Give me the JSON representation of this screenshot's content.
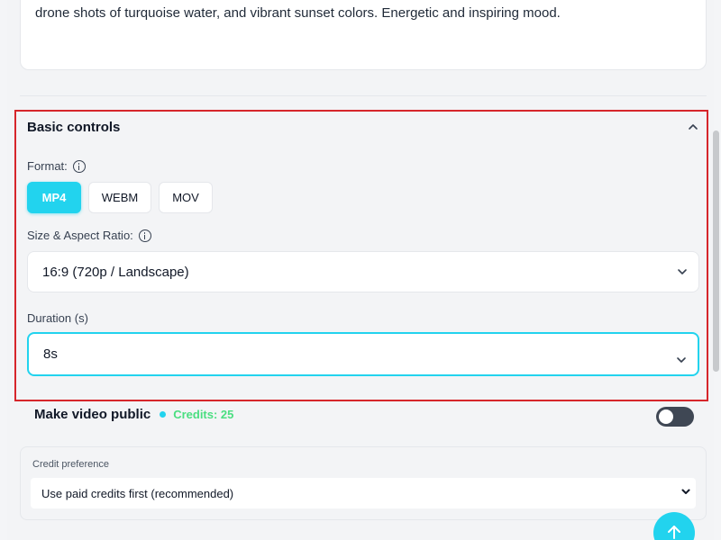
{
  "prompt": {
    "text": "drone shots of turquoise water, and vibrant sunset colors. Energetic and inspiring mood."
  },
  "basic_controls": {
    "title": "Basic controls",
    "format": {
      "label": "Format:",
      "options": [
        "MP4",
        "WEBM",
        "MOV"
      ],
      "selected": "MP4"
    },
    "size": {
      "label": "Size & Aspect Ratio:",
      "value": "16:9 (720p / Landscape)"
    },
    "duration": {
      "label": "Duration (s)",
      "value": "8s"
    }
  },
  "public": {
    "label": "Make video public",
    "credits": "Credits: 25",
    "toggle_on": false
  },
  "credit_preference": {
    "label": "Credit preference",
    "value": "Use paid credits first (recommended)"
  },
  "colors": {
    "accent": "#22d3ee",
    "credits": "#4ade80",
    "highlight_border": "#d6262b"
  },
  "icons": {
    "collapse": "chevron-up-icon",
    "info": "info-icon",
    "dropdown": "chevron-down-icon",
    "fab": "arrow-up-icon"
  }
}
